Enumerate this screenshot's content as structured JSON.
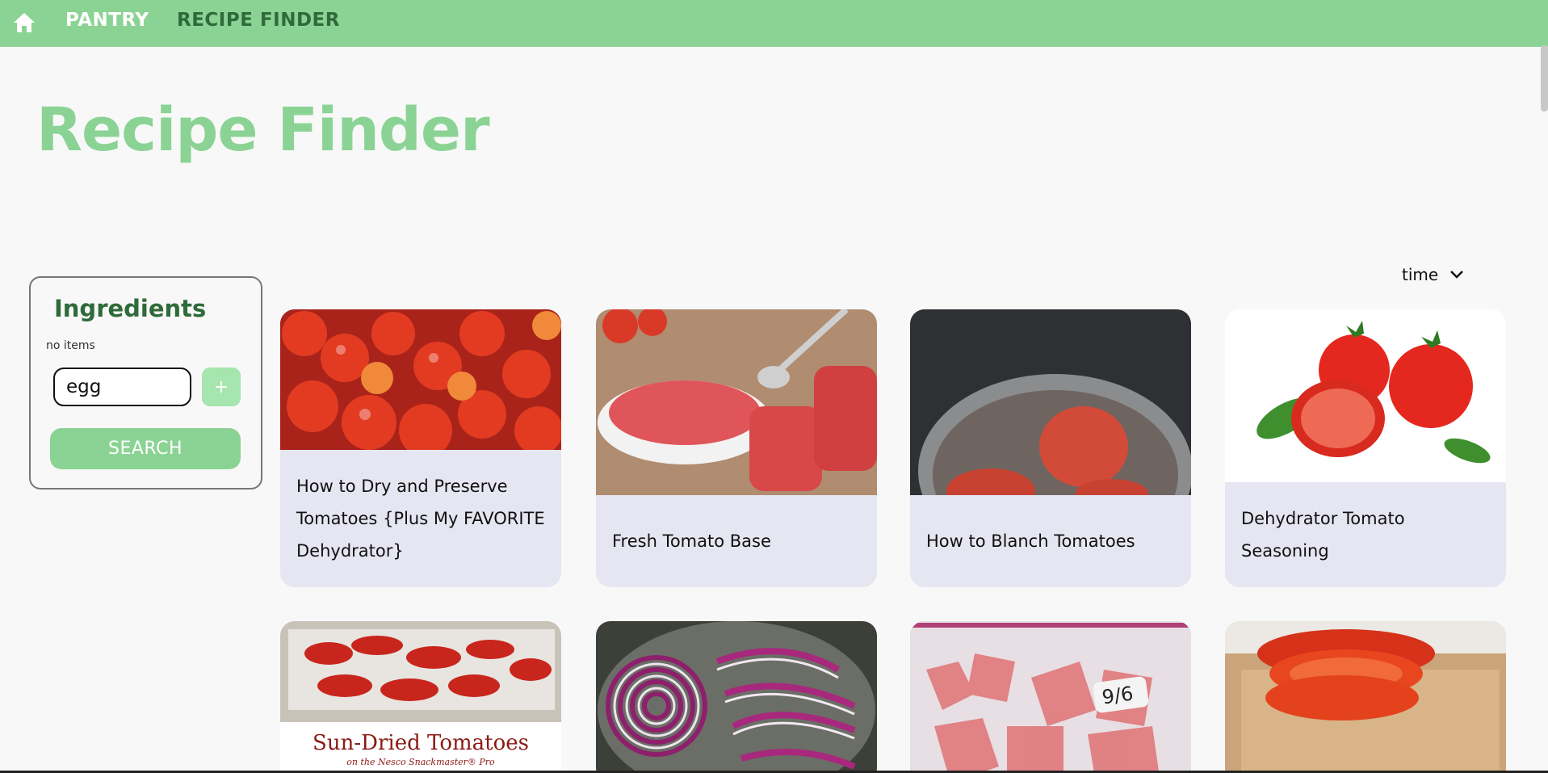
{
  "nav": {
    "home_icon": "home-icon",
    "pantry_label": "PANTRY",
    "recipe_finder_label": "RECIPE FINDER"
  },
  "page": {
    "title": "Recipe Finder"
  },
  "ingredients": {
    "title": "Ingredients",
    "empty_text": "no items",
    "input_value": "egg",
    "add_label": "+",
    "search_label": "SEARCH"
  },
  "sort": {
    "selected": "time",
    "icon": "chevron-down-icon"
  },
  "recipes": [
    {
      "title": "How to Dry and Preserve Tomatoes {Plus My FAVORITE Dehydrator}",
      "image": "cherry-tomatoes-photo"
    },
    {
      "title": "Fresh Tomato Base",
      "image": "tomato-puree-jars-photo"
    },
    {
      "title": "How to Blanch Tomatoes",
      "image": "tomatoes-in-pot-photo"
    },
    {
      "title": "Dehydrator Tomato Seasoning",
      "image": "tomatoes-basil-photo"
    },
    {
      "title": "",
      "image": "sun-dried-tomatoes-photo",
      "image_text": "Sun-Dried Tomatoes",
      "image_subtext": "on the Nesco Snackmaster® Pro"
    },
    {
      "title": "",
      "image": "red-onion-slices-photo"
    },
    {
      "title": "",
      "image": "frozen-tomatoes-bag-photo",
      "image_text": "9/6"
    },
    {
      "title": "",
      "image": "sliced-tomato-board-photo"
    }
  ],
  "colors": {
    "accent": "#8bd394",
    "dark_green": "#2f6b3a",
    "card_bg": "#e6e6f2"
  }
}
